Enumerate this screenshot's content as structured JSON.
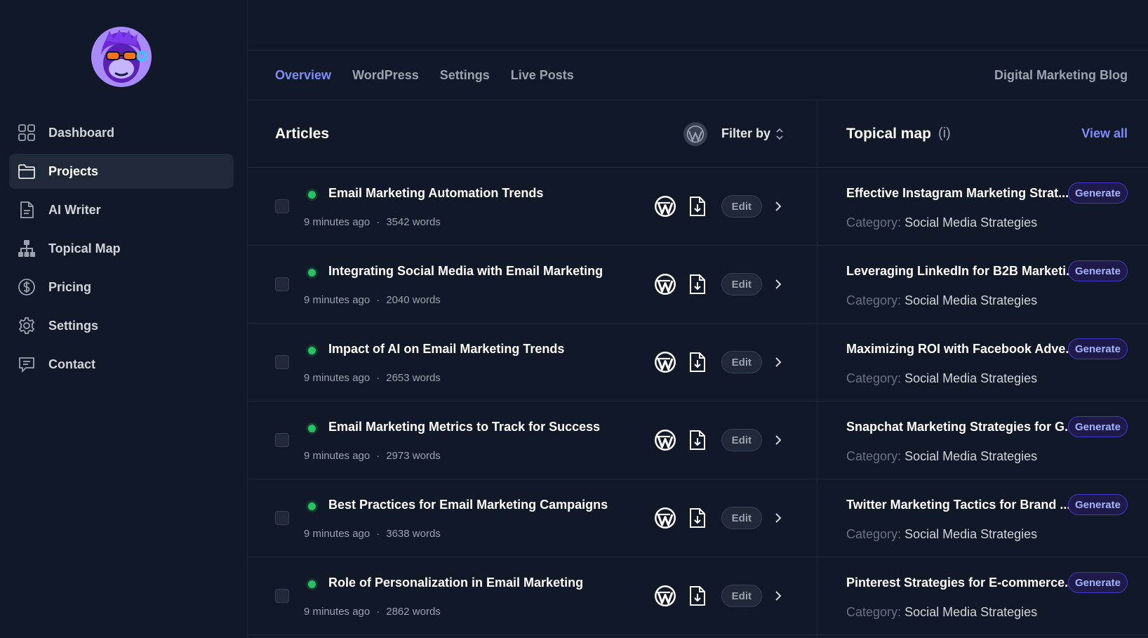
{
  "sidebar": {
    "items": [
      {
        "label": "Dashboard",
        "icon": "grid-icon"
      },
      {
        "label": "Projects",
        "icon": "folder-icon",
        "active": true
      },
      {
        "label": "AI Writer",
        "icon": "document-icon"
      },
      {
        "label": "Topical Map",
        "icon": "hierarchy-icon"
      },
      {
        "label": "Pricing",
        "icon": "dollar-icon"
      },
      {
        "label": "Settings",
        "icon": "gear-icon"
      },
      {
        "label": "Contact",
        "icon": "chat-icon"
      }
    ]
  },
  "header": {
    "tabs": [
      "Overview",
      "WordPress",
      "Settings",
      "Live Posts"
    ],
    "active_tab": "Overview",
    "project_name": "Digital Marketing Blog"
  },
  "articles": {
    "title": "Articles",
    "filter_label": "Filter by",
    "edit_label": "Edit",
    "rows": [
      {
        "title": "Email Marketing Automation Trends",
        "time": "9 minutes ago",
        "words": "3542 words"
      },
      {
        "title": "Integrating Social Media with Email Marketing",
        "time": "9 minutes ago",
        "words": "2040 words"
      },
      {
        "title": "Impact of AI on Email Marketing Trends",
        "time": "9 minutes ago",
        "words": "2653 words"
      },
      {
        "title": "Email Marketing Metrics to Track for Success",
        "time": "9 minutes ago",
        "words": "2973 words"
      },
      {
        "title": "Best Practices for Email Marketing Campaigns",
        "time": "9 minutes ago",
        "words": "3638 words"
      },
      {
        "title": "Role of Personalization in Email Marketing",
        "time": "9 minutes ago",
        "words": "2862 words"
      }
    ]
  },
  "topical_map": {
    "title": "Topical map",
    "info": "(i)",
    "view_all_label": "View all",
    "generate_label": "Generate",
    "category_label": "Category:",
    "rows": [
      {
        "title": "Effective Instagram Marketing Strat...",
        "category": "Social Media Strategies"
      },
      {
        "title": "Leveraging LinkedIn for B2B Marketi...",
        "category": "Social Media Strategies"
      },
      {
        "title": "Maximizing ROI with Facebook Adve...",
        "category": "Social Media Strategies"
      },
      {
        "title": "Snapchat Marketing Strategies for G...",
        "category": "Social Media Strategies"
      },
      {
        "title": "Twitter Marketing Tactics for Brand ...",
        "category": "Social Media Strategies"
      },
      {
        "title": "Pinterest Strategies for E-commerce...",
        "category": "Social Media Strategies"
      }
    ]
  },
  "colors": {
    "background": "#111827",
    "accent": "#818cf8",
    "status_published": "#22c55e"
  }
}
